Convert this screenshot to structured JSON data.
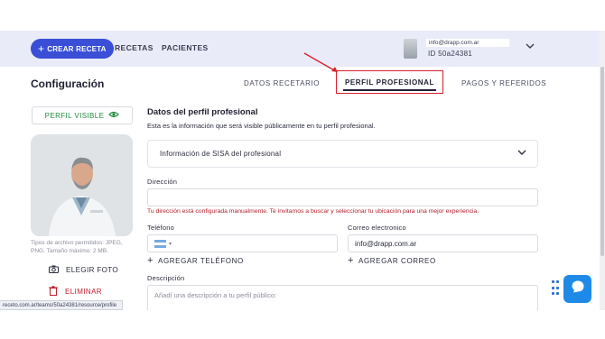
{
  "header": {
    "create_button": "CREAR RECETA",
    "nav": [
      "RECETAS",
      "PACIENTES"
    ],
    "user_email": "info@drapp.com.ar",
    "user_id": "ID 50a24381"
  },
  "page": {
    "title": "Configuración",
    "tabs": [
      "DATOS RECETARIO",
      "PERFIL PROFESIONAL",
      "PAGOS Y REFERIDOS"
    ],
    "active_tab": "PERFIL PROFESIONAL"
  },
  "sidebar": {
    "visible_button": "PERFIL VISIBLE",
    "file_hint": "Tipos de archivo permitidos: JPEG, PNG. Tamaño máximo: 2 MB.",
    "choose_photo": "ELEGIR FOTO",
    "delete": "ELIMINAR"
  },
  "profile": {
    "section_title": "Datos del perfil profesional",
    "section_sub": "Esta es la información que será visible públicamente en tu perfil profesional.",
    "sisa_label": "Información de SISA del profesional",
    "address_label": "Dirección",
    "address_value": "",
    "address_helper": "Tu dirección está configurada manualmente. Te invitamos a buscar y seleccionar tu ubicación para una mejor experiencia.",
    "phone_label": "Teléfono",
    "phone_value": "",
    "email_label": "Correo electronico",
    "email_value": "info@drapp.com.ar",
    "add_phone": "AGREGAR TELÉFONO",
    "add_email": "AGREGAR CORREO",
    "description_label": "Descripción",
    "description_placeholder": "Añadí una descripción a tu perfil público:"
  },
  "status_bar": {
    "url": "receto.com.ar/teams/50a24381/resource/profile"
  },
  "colors": {
    "primary": "#3a4fd6",
    "header_bg": "#e9ebf8",
    "visible_green": "#1f8a3c",
    "error_red": "#b4202c",
    "annotation_red": "#d6202f",
    "chat_blue": "#1e8ae8"
  },
  "icons": [
    "plus-icon",
    "chevron-down-icon",
    "eye-icon",
    "camera-icon",
    "trash-icon",
    "flag-argentina-icon",
    "chat-icon",
    "grip-icon"
  ]
}
